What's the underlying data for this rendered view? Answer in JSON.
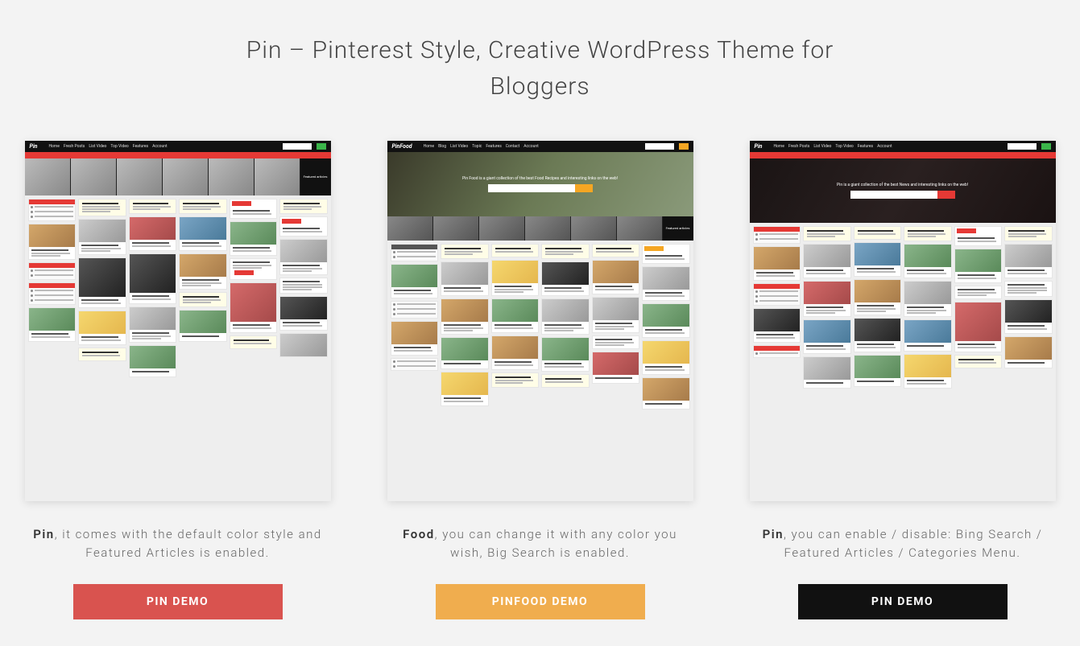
{
  "title": "Pin – Pinterest Style, Creative WordPress Theme for Bloggers",
  "columns": [
    {
      "thumb": {
        "logo": "Pin",
        "nav": [
          "Home",
          "Fresh Posts",
          "List Video",
          "Top Video",
          "Features",
          "Account"
        ],
        "featured_label": "Featured articles"
      },
      "desc_bold": "Pin",
      "desc_rest": ", it comes with the default color style and Featured Articles is enabled.",
      "button": "PIN DEMO",
      "button_class": "btn-red"
    },
    {
      "thumb": {
        "logo": "PinFood",
        "nav": [
          "Home",
          "Blog",
          "List Video",
          "Topic",
          "Features",
          "Contact",
          "Account"
        ],
        "hero_text": "Pin Food is a giant collection of the best Food Recipes and interesting links on the web!",
        "featured_label": "Featured articles"
      },
      "desc_bold": "Food",
      "desc_rest": ", you can change it with any color you wish, Big Search is enabled.",
      "button": "PINFOOD DEMO",
      "button_class": "btn-orange"
    },
    {
      "thumb": {
        "logo": "Pin",
        "nav": [
          "Home",
          "Fresh Posts",
          "List Video",
          "Top Video",
          "Features",
          "Account"
        ],
        "hero_text": "Pin is a giant collection of the best News and interesting links on the web!"
      },
      "desc_bold": "Pin",
      "desc_rest": ", you can enable / disable: Bing Search / Featured Articles / Categories Menu.",
      "button": "PIN DEMO",
      "button_class": "btn-black"
    }
  ]
}
